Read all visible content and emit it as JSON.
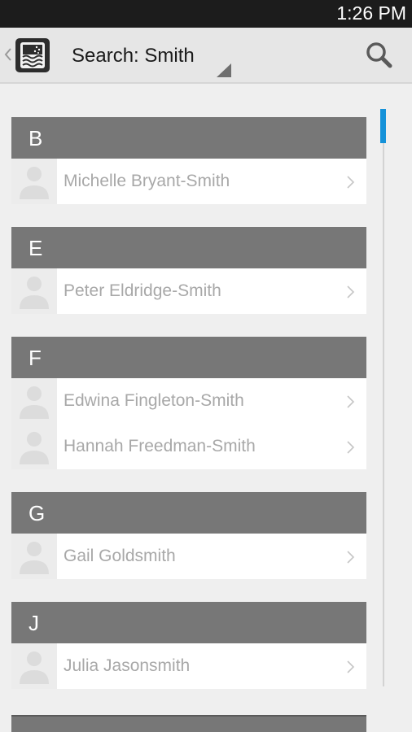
{
  "status_bar": {
    "time": "1:26 PM"
  },
  "action_bar": {
    "back_icon": "chevron-left-icon",
    "logo_icon": "app-logo-icon",
    "title": "Search: Smith",
    "spinner_icon": "dropdown-triangle-icon",
    "search_icon": "search-icon"
  },
  "sections": [
    {
      "letter": "B",
      "people": [
        {
          "name": "Michelle Bryant-Smith"
        }
      ]
    },
    {
      "letter": "E",
      "people": [
        {
          "name": "Peter Eldridge-Smith"
        }
      ]
    },
    {
      "letter": "F",
      "people": [
        {
          "name": "Edwina Fingleton-Smith"
        },
        {
          "name": "Hannah Freedman-Smith"
        }
      ]
    },
    {
      "letter": "G",
      "people": [
        {
          "name": "Gail Goldsmith"
        }
      ]
    },
    {
      "letter": "J",
      "people": [
        {
          "name": "Julia Jasonsmith"
        }
      ]
    }
  ],
  "colors": {
    "section_header": "#777777",
    "name_text": "#a8a8a8",
    "scrollbar_accent": "#1592d9",
    "status_bar": "#1c1c1c"
  }
}
